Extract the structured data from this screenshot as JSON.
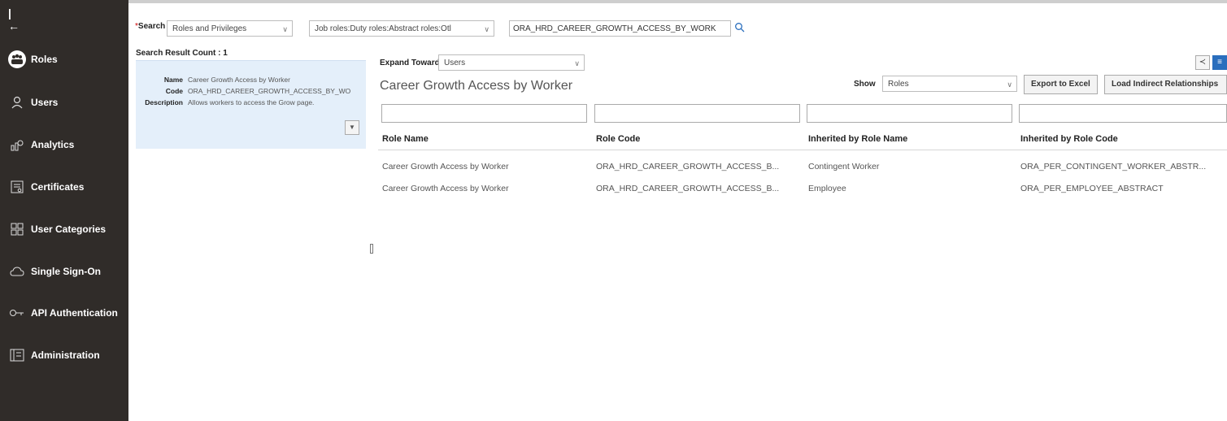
{
  "sidebar": {
    "collapse_icon": "collapse-left-icon",
    "items": [
      {
        "label": "Roles",
        "icon": "roles-icon",
        "active": true
      },
      {
        "label": "Users",
        "icon": "user-icon"
      },
      {
        "label": "Analytics",
        "icon": "analytics-icon"
      },
      {
        "label": "Certificates",
        "icon": "certificate-icon"
      },
      {
        "label": "User Categories",
        "icon": "grid-icon"
      },
      {
        "label": "Single Sign-On",
        "icon": "cloud-icon"
      },
      {
        "label": "API Authentication",
        "icon": "key-icon"
      },
      {
        "label": "Administration",
        "icon": "admin-icon"
      }
    ]
  },
  "search": {
    "required_mark": "*",
    "label": "Search",
    "category_value": "Roles and Privileges",
    "role_types_value": "Job roles:Duty roles:Abstract roles:Otl",
    "query_value": "ORA_HRD_CAREER_GROWTH_ACCESS_BY_WORK"
  },
  "result": {
    "count_label": "Search Result Count : 1",
    "name_key": "Name",
    "name_value": "Career Growth Access by Worker",
    "code_key": "Code",
    "code_value": "ORA_HRD_CAREER_GROWTH_ACCESS_BY_WO",
    "description_key": "Description",
    "description_value": "Allows workers to access the Grow page."
  },
  "main": {
    "expand_label": "Expand Toward",
    "expand_value": "Users",
    "title": "Career Growth Access by Worker",
    "show_label": "Show",
    "show_value": "Roles",
    "export_button": "Export to Excel",
    "load_button": "Load Indirect Relationships"
  },
  "table": {
    "columns": [
      "Role Name",
      "Role Code",
      "Inherited by Role Name",
      "Inherited by Role Code"
    ],
    "rows": [
      [
        "Career Growth Access by Worker",
        "ORA_HRD_CAREER_GROWTH_ACCESS_B...",
        "Contingent Worker",
        "ORA_PER_CONTINGENT_WORKER_ABSTR..."
      ],
      [
        "Career Growth Access by Worker",
        "ORA_HRD_CAREER_GROWTH_ACCESS_B...",
        "Employee",
        "ORA_PER_EMPLOYEE_ABSTRACT"
      ]
    ]
  }
}
